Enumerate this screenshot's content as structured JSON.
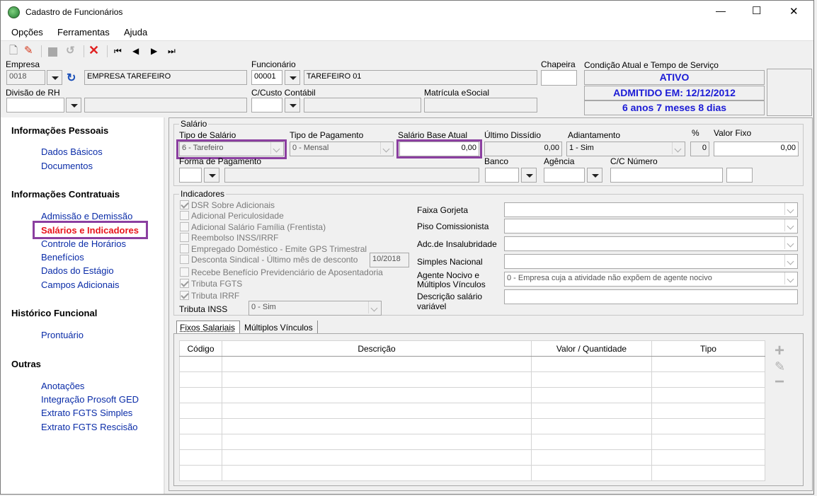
{
  "window": {
    "title": "Cadastro de Funcionários",
    "controls": {
      "minimize": "—",
      "maximize": "☐",
      "close": "✕"
    }
  },
  "menu": [
    {
      "label": "Opções"
    },
    {
      "label": "Ferramentas"
    },
    {
      "label": "Ajuda"
    }
  ],
  "header": {
    "empresa_label": "Empresa",
    "empresa_code": "0018",
    "empresa_name": "EMPRESA TAREFEIRO",
    "funcionario_label": "Funcionário",
    "funcionario_code": "00001",
    "funcionario_name": "TAREFEIRO 01",
    "chapeira_label": "Chapeira",
    "chapeira_value": "",
    "condicao_label": "Condição Atual e Tempo de Serviço",
    "status": "ATIVO",
    "admitido": "ADMITIDO EM: 12/12/2012",
    "tempo": "6 anos 7 meses 8 dias",
    "divisao_label": "Divisão de RH",
    "ccusto_label": "C/Custo Contábil",
    "matricula_label": "Matrícula eSocial"
  },
  "sidebar": {
    "sections": [
      {
        "title": "Informações Pessoais",
        "items": [
          "Dados Básicos",
          "Documentos"
        ]
      },
      {
        "title": "Informações Contratuais",
        "items": [
          "Admissão e Demissão",
          "Salários e Indicadores",
          "Controle de Horários",
          "Benefícios",
          "Dados do Estágio",
          "Campos Adicionais"
        ]
      },
      {
        "title": "Histórico Funcional",
        "items": [
          "Prontuário"
        ]
      },
      {
        "title": "Outras",
        "items": [
          "Anotações",
          "Integração Prosoft GED",
          "Extrato FGTS Simples",
          "Extrato FGTS Rescisão"
        ]
      }
    ],
    "active_item": "Salários e Indicadores",
    "active_color": "#e8141c"
  },
  "salario": {
    "group_title": "Salário",
    "tipo_label": "Tipo de Salário",
    "tipo_value": "6 - Tarefeiro",
    "pagamento_label": "Tipo de Pagamento",
    "pagamento_value": "0 - Mensal",
    "base_label": "Salário Base Atual",
    "base_value": "0,00",
    "dissidio_label": "Último Dissídio",
    "dissidio_value": "0,00",
    "adiantamento_label": "Adiantamento",
    "adiantamento_value": "1 - Sim",
    "pct_label": "%",
    "pct_value": "0",
    "valor_fixo_label": "Valor Fixo",
    "valor_fixo_value": "0,00",
    "forma_label": "Forma de Pagamento",
    "banco_label": "Banco",
    "agencia_label": "Agência",
    "cc_label": "C/C Número"
  },
  "indicadores": {
    "group_title": "Indicadores",
    "checks": [
      {
        "label": "DSR Sobre Adicionais",
        "checked": true
      },
      {
        "label": "Adicional Periculosidade",
        "checked": false
      },
      {
        "label": "Adicional Salário Família (Frentista)",
        "checked": false
      },
      {
        "label": "Reembolso INSS/IRRF",
        "checked": false
      },
      {
        "label": "Empregado Doméstico - Emite GPS Trimestral",
        "checked": false
      },
      {
        "label": "Desconta Sindical - Último mês de desconto",
        "checked": false
      },
      {
        "label": "Recebe Benefício Previdenciário de Aposentadoria",
        "checked": false
      },
      {
        "label": "Tributa FGTS",
        "checked": true
      },
      {
        "label": "Tributa IRRF",
        "checked": true
      }
    ],
    "sindical_date": "10/2018",
    "tributa_inss_label": "Tributa INSS",
    "tributa_inss_value": "0 - Sim",
    "faixa_label": "Faixa Gorjeta",
    "piso_label": "Piso Comissionista",
    "insalubridade_label": "Adc.de Insalubridade",
    "simples_label": "Simples Nacional",
    "agente_label_1": "Agente Nocivo e",
    "agente_label_2": "Múltiplos Vínculos",
    "agente_value": "0 - Empresa cuja a atividade não expõem de agente nocivo",
    "descricao_label_1": "Descrição salário",
    "descricao_label_2": "variável"
  },
  "tabs": [
    {
      "label": "Fixos Salariais",
      "active": true
    },
    {
      "label": "Múltiplos Vínculos",
      "active": false
    }
  ],
  "table": {
    "columns": [
      "Código",
      "Descrição",
      "Valor / Quantidade",
      "Tipo"
    ],
    "rows": []
  },
  "side_buttons": {
    "add": "+",
    "edit": "✎",
    "remove": "−"
  },
  "colors": {
    "status_blue": "#1b1bd6",
    "link_blue": "#0a2ca8",
    "highlight": "#8b3fa0"
  }
}
